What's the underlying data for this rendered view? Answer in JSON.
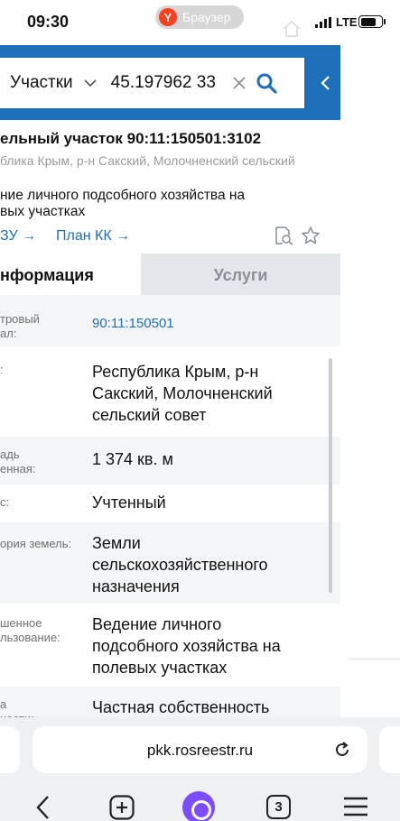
{
  "status_bar": {
    "time": "09:30",
    "browser_label": "Браузер",
    "browser_badge": "Y",
    "network": "LTE",
    "battery_level": 0.75
  },
  "search": {
    "type_label": "Участки",
    "query": "45.197962 33"
  },
  "parcel": {
    "title": "ельный участок 90:11:150501:3102",
    "subtitle": "блика Крым, р-н Сакский, Молочненский сельский",
    "purpose": "ние личного подсобного хозяйства на\nвых участках",
    "link_zu": "ЗУ →",
    "link_kk": "План КК →"
  },
  "tabs": {
    "info": "нформация",
    "services": "Услуги"
  },
  "rows": [
    {
      "label": "тровый\nал:",
      "value": "90:11:150501",
      "link": true
    },
    {
      "label": ":",
      "value": "Республика Крым, р-н\nСакский, Молочненский\nсельский совет",
      "link": false
    },
    {
      "label": "адь\nенная:",
      "value": "1 374 кв. м",
      "link": false
    },
    {
      "label": "с:",
      "value": "Учтенный",
      "link": false
    },
    {
      "label": "ория земель:",
      "value": "Земли\nсельскохозяйственного\nназначения",
      "link": false
    },
    {
      "label": "шенное\nльзование:",
      "value": "Ведение личного\nподсобного хозяйства на\nполевых участках",
      "link": false
    },
    {
      "label": "а\nности:",
      "value": "Частная собственность",
      "link": false
    }
  ],
  "address_bar": {
    "url": "pkk.rosreestr.ru"
  },
  "bottom_nav": {
    "tabs_count": "3"
  },
  "colors": {
    "accent": "#1e6fba",
    "alice": "#7b4dff",
    "yandex": "#fc3f1d"
  }
}
